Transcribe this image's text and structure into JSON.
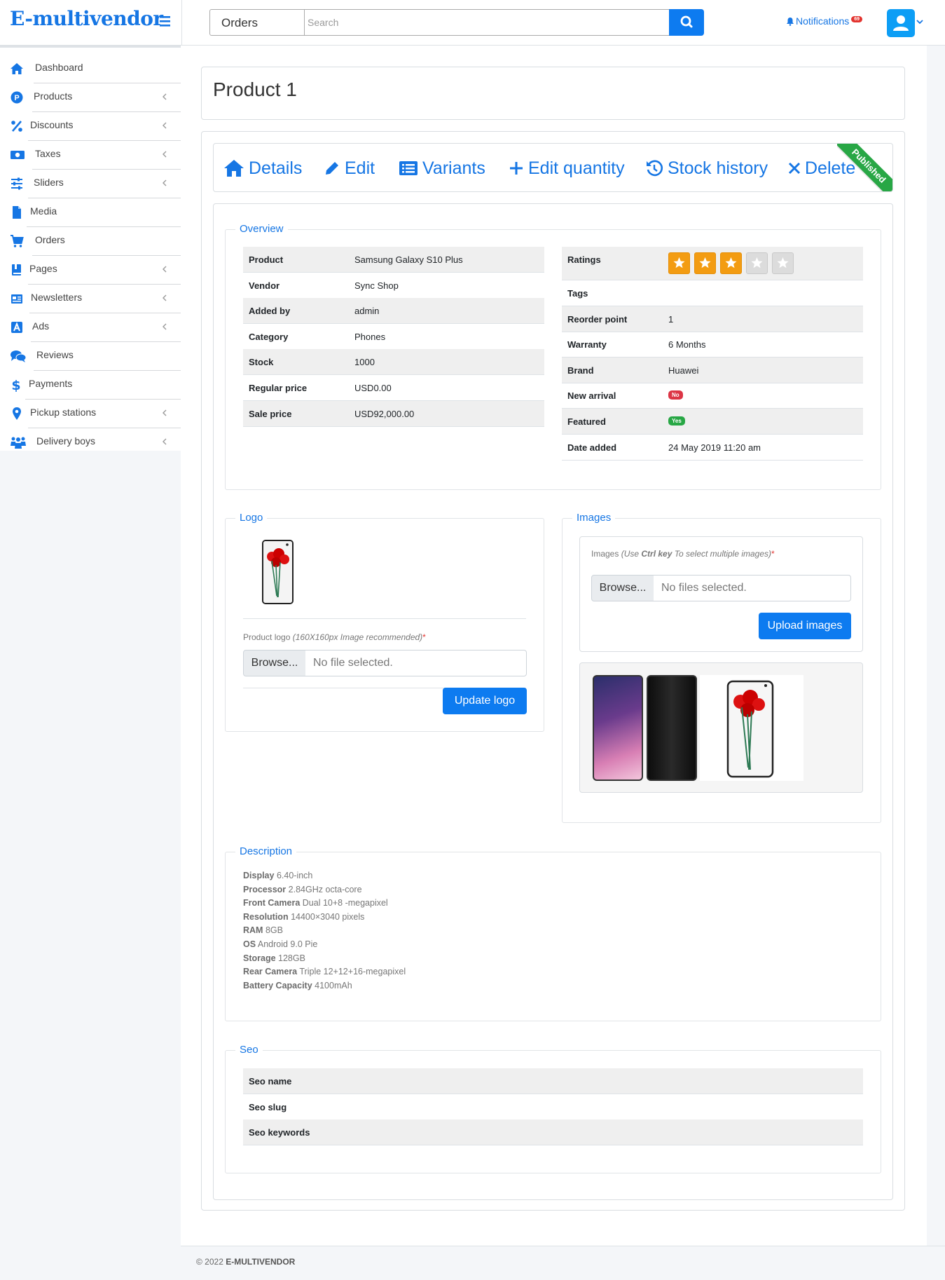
{
  "app": {
    "brand": "E-multivendor"
  },
  "search": {
    "selected_option": "Orders",
    "placeholder": "Search"
  },
  "header": {
    "notifications_label": "Notifications",
    "notifications_count": "69"
  },
  "sidebar": {
    "items": [
      {
        "label": "Dashboard",
        "icon": "home-icon",
        "has_submenu": false
      },
      {
        "label": "Products",
        "icon": "product-icon",
        "has_submenu": true
      },
      {
        "label": "Discounts",
        "icon": "percent-icon",
        "has_submenu": true
      },
      {
        "label": "Taxes",
        "icon": "money-icon",
        "has_submenu": true
      },
      {
        "label": "Sliders",
        "icon": "sliders-icon",
        "has_submenu": true
      },
      {
        "label": "Media",
        "icon": "file-icon",
        "has_submenu": false
      },
      {
        "label": "Orders",
        "icon": "cart-icon",
        "has_submenu": false
      },
      {
        "label": "Pages",
        "icon": "book-icon",
        "has_submenu": true
      },
      {
        "label": "Newsletters",
        "icon": "newspaper-icon",
        "has_submenu": true
      },
      {
        "label": "Ads",
        "icon": "ad-icon",
        "has_submenu": true
      },
      {
        "label": "Reviews",
        "icon": "comments-icon",
        "has_submenu": false
      },
      {
        "label": "Payments",
        "icon": "dollar-icon",
        "has_submenu": false
      },
      {
        "label": "Pickup stations",
        "icon": "map-marker-icon",
        "has_submenu": true
      },
      {
        "label": "Delivery boys",
        "icon": "people-icon",
        "has_submenu": true
      }
    ]
  },
  "page": {
    "title": "Product 1"
  },
  "tabs": {
    "details": "Details",
    "edit": "Edit",
    "variants": "Variants",
    "edit_quantity": "Edit quantity",
    "stock_history": "Stock history",
    "delete": "Delete",
    "ribbon": "Published"
  },
  "overview": {
    "legend": "Overview",
    "left": [
      {
        "key": "Product",
        "value": "Samsung Galaxy S10 Plus"
      },
      {
        "key": "Vendor",
        "value": "Sync Shop"
      },
      {
        "key": "Added by",
        "value": "admin"
      },
      {
        "key": "Category",
        "value": "Phones"
      },
      {
        "key": "Stock",
        "value": "1000"
      },
      {
        "key": "Regular price",
        "value": "USD0.00"
      },
      {
        "key": "Sale price",
        "value": "USD92,000.00"
      }
    ],
    "ratings_label": "Ratings",
    "rating": 3,
    "rating_max": 5,
    "right": [
      {
        "key": "Tags",
        "value": ""
      },
      {
        "key": "Reorder point",
        "value": "1"
      },
      {
        "key": "Warranty",
        "value": "6 Months"
      },
      {
        "key": "Brand",
        "value": "Huawei"
      },
      {
        "key": "New arrival",
        "value": "No",
        "badge": "#dc3545"
      },
      {
        "key": "Featured",
        "value": "Yes",
        "badge": "#28a745"
      },
      {
        "key": "Date added",
        "value": "24 May 2019 11:20 am"
      }
    ]
  },
  "logo": {
    "legend": "Logo",
    "field_label": "Product logo",
    "field_hint": "(160X160px Image recommended)",
    "required_mark": "*",
    "browse": "Browse...",
    "file_status": "No file selected.",
    "button": "Update logo"
  },
  "images": {
    "legend": "Images",
    "field_label": "Images",
    "hint_prefix": "(Use ",
    "hint_key": "Ctrl key",
    "hint_suffix": " To select multiple images)",
    "required_mark": "*",
    "browse": "Browse...",
    "file_status": "No files selected.",
    "button": "Upload images"
  },
  "description": {
    "legend": "Description",
    "lines": [
      {
        "k": "Display",
        "v": "6.40-inch"
      },
      {
        "k": "Processor",
        "v": "2.84GHz octa-core"
      },
      {
        "k": "Front Camera",
        "v": "Dual 10+8 -megapixel"
      },
      {
        "k": "Resolution",
        "v": "14400×3040 pixels"
      },
      {
        "k": "RAM",
        "v": "8GB"
      },
      {
        "k": "OS",
        "v": "Android 9.0 Pie"
      },
      {
        "k": "Storage",
        "v": "128GB"
      },
      {
        "k": "Rear Camera",
        "v": "Triple 12+12+16-megapixel"
      },
      {
        "k": "Battery Capacity",
        "v": "4100mAh"
      }
    ]
  },
  "seo": {
    "legend": "Seo",
    "rows": [
      {
        "key": "Seo name"
      },
      {
        "key": "Seo slug"
      },
      {
        "key": "Seo keywords"
      }
    ]
  },
  "footer": {
    "copyright": "© 2022",
    "brand": "E-MULTIVENDOR"
  },
  "colors": {
    "accent": "#1676e4",
    "primary_button": "#0d7bf0",
    "star": "#f39c12",
    "published": "#28a745",
    "danger": "#dc3545"
  }
}
